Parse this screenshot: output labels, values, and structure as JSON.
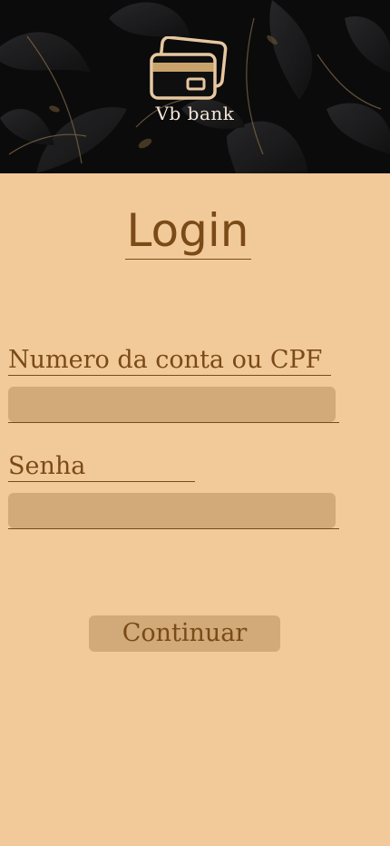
{
  "brand": {
    "name": "Vb bank",
    "icon": "credit-cards-icon"
  },
  "title": "Login",
  "form": {
    "account_label": "Numero da conta ou CPF",
    "account_value": "",
    "password_label": "Senha",
    "password_value": "",
    "submit_label": "Continuar"
  },
  "colors": {
    "background": "#f2ca99",
    "header_background": "#0b0b0c",
    "text": "#7a4a17",
    "input_fill": "#d2a979",
    "brand_text": "#f4e6d8",
    "gold_accent": "#c9a26b"
  }
}
